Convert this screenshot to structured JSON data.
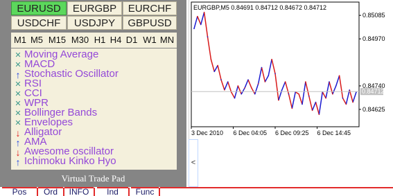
{
  "symbols": [
    "EURUSD",
    "EURGBP",
    "EURCHF",
    "USDCHF",
    "USDJPY",
    "GBPUSD"
  ],
  "active_symbol": "EURUSD",
  "timeframes": [
    "M1",
    "M5",
    "M15",
    "M30",
    "H1",
    "H4",
    "D1",
    "W1",
    "MN"
  ],
  "indicators": [
    {
      "label": "Moving Average",
      "signal": "neutral",
      "icon": "cross-icon"
    },
    {
      "label": "MACD",
      "signal": "neutral",
      "icon": "cross-icon"
    },
    {
      "label": "Stochastic Oscillator",
      "signal": "up",
      "icon": "up-arrow-icon"
    },
    {
      "label": "RSI",
      "signal": "neutral",
      "icon": "cross-icon"
    },
    {
      "label": "CCI",
      "signal": "neutral",
      "icon": "cross-icon"
    },
    {
      "label": "WPR",
      "signal": "neutral",
      "icon": "cross-icon"
    },
    {
      "label": "Bollinger Bands",
      "signal": "neutral",
      "icon": "cross-icon"
    },
    {
      "label": "Envelopes",
      "signal": "neutral",
      "icon": "cross-icon"
    },
    {
      "label": "Alligator",
      "signal": "down",
      "icon": "down-arrow-icon"
    },
    {
      "label": "AMA",
      "signal": "up",
      "icon": "up-arrow-icon"
    },
    {
      "label": "Awesome oscillator",
      "signal": "down",
      "icon": "down-arrow-icon"
    },
    {
      "label": "Ichimoku Kinko Hyo",
      "signal": "up",
      "icon": "up-arrow-icon"
    }
  ],
  "pad_title": "Virtual Trade Pad",
  "collapse_label": "<",
  "tabs": [
    "Pos",
    "Ord",
    "INFO",
    "Ind",
    "Func"
  ],
  "colors": {
    "active_symbol": "#5cd85c",
    "indicator_text": "#9448d8",
    "up": "#1a3de0",
    "down": "#e01818",
    "bull_bar": "#1a1ad0",
    "bear_bar": "#d81a1a"
  },
  "chart_data": {
    "type": "line",
    "header": "EURGBP,M5  0.84691 0.84712 0.84672 0.84712",
    "symbol": "EURGBP",
    "timeframe": "M5",
    "ohlc": {
      "open": 0.84691,
      "high": 0.84712,
      "low": 0.84672,
      "close": 0.84712
    },
    "current_price_label": "0.84712",
    "y_ticks": [
      "0.85085",
      "0.84970",
      "0.84740",
      "0.84625"
    ],
    "x_ticks": [
      "3 Dec 2010",
      "6 Dec 04:05",
      "6 Dec 09:25",
      "6 Dec 14:45"
    ],
    "ylim": [
      0.8454,
      0.8515
    ],
    "x": [
      0,
      5,
      10,
      15,
      20,
      25,
      30,
      35,
      40,
      45,
      50,
      55,
      60,
      65,
      70,
      75,
      80,
      85,
      90,
      95,
      100,
      105,
      110,
      115,
      120,
      125,
      130,
      135,
      140,
      145,
      150,
      155,
      160,
      165,
      170,
      175,
      180,
      185,
      190,
      195,
      200,
      205,
      210,
      215,
      220,
      225,
      230,
      235,
      240
    ],
    "values": [
      0.8502,
      0.8508,
      0.8504,
      0.851,
      0.8498,
      0.8487,
      0.8481,
      0.8484,
      0.8477,
      0.8472,
      0.8476,
      0.8471,
      0.8468,
      0.8474,
      0.847,
      0.8473,
      0.8477,
      0.8473,
      0.847,
      0.8475,
      0.8483,
      0.8476,
      0.8479,
      0.8487,
      0.848,
      0.8467,
      0.8472,
      0.8476,
      0.847,
      0.8463,
      0.8471,
      0.847,
      0.8465,
      0.8476,
      0.8469,
      0.8462,
      0.8466,
      0.846,
      0.8471,
      0.8468,
      0.8476,
      0.847,
      0.8474,
      0.8479,
      0.8468,
      0.8465,
      0.8472,
      0.8466,
      0.8471
    ],
    "grid": false
  }
}
